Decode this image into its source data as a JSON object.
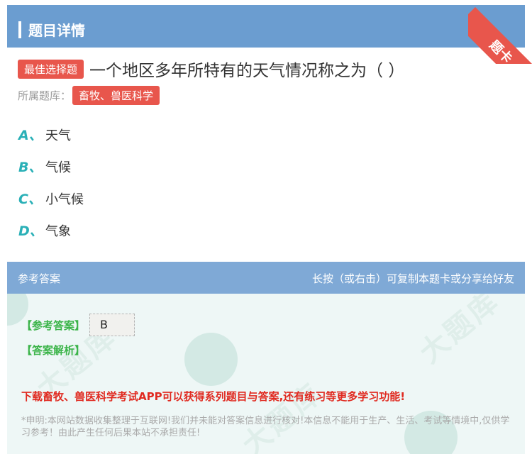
{
  "header": {
    "title": "题目详情"
  },
  "ribbon": {
    "label": "题卡"
  },
  "question": {
    "type_badge": "最佳选择题",
    "text": "一个地区多年所特有的天气情况称之为（ ）",
    "bank_label": "所属题库：",
    "bank_name": "畜牧、兽医科学"
  },
  "options": [
    {
      "letter": "A、",
      "text": "天气"
    },
    {
      "letter": "B、",
      "text": "气候"
    },
    {
      "letter": "C、",
      "text": "小气候"
    },
    {
      "letter": "D、",
      "text": "气象"
    }
  ],
  "answer": {
    "bar_title": "参考答案",
    "bar_hint": "长按（或右击）可复制本题卡或分享给好友",
    "ref_label": "【参考答案】",
    "ref_value": "B",
    "analysis_label": "【答案解析】",
    "promo": "下载畜牧、兽医科学考试APP可以获得系列题目与答案,还有练习等更多学习功能!",
    "disclaimer": "*申明:本网站数据收集整理于互联网!我们并未能对答案信息进行核对!本信息不能用于生产、生活、考试等情境中,仅供学习参考！由此产生任何后果本站不承担责任!"
  },
  "colors": {
    "header": "#6b9dd0",
    "accent_red": "#e8564c",
    "option_letter": "#2ab0b7",
    "answer_bar": "#7fa9d6",
    "green_label": "#3bb449",
    "promo_red": "#e02a20"
  }
}
